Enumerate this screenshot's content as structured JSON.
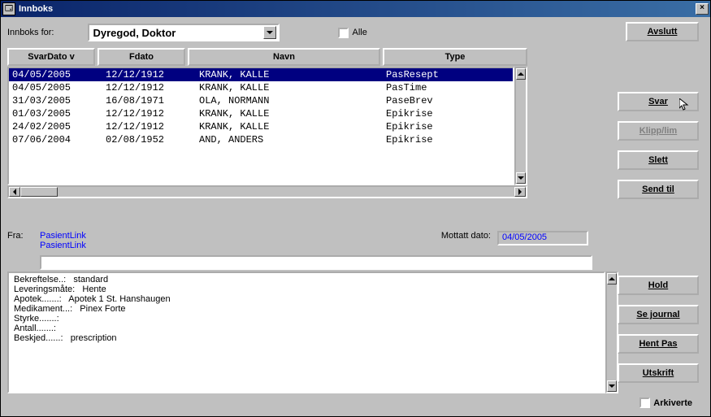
{
  "title": "Innboks",
  "labels": {
    "innboks_for": "Innboks for:",
    "alle": "Alle",
    "fra": "Fra:",
    "mottatt_dato": "Mottatt dato:",
    "arkiverte": "Arkiverte"
  },
  "dropdown": {
    "selected": "Dyregod, Doktor"
  },
  "headers": {
    "svardato": "SvarDato  v",
    "fdato": "Fdato",
    "navn": "Navn",
    "type": "Type"
  },
  "rows": [
    {
      "svardato": "04/05/2005",
      "fdato": "12/12/1912",
      "navn": "KRANK, KALLE",
      "type": "PasResept",
      "selected": true
    },
    {
      "svardato": "04/05/2005",
      "fdato": "12/12/1912",
      "navn": "KRANK, KALLE",
      "type": "PasTime",
      "selected": false
    },
    {
      "svardato": "31/03/2005",
      "fdato": "16/08/1971",
      "navn": "OLA, NORMANN",
      "type": "PaseBrev",
      "selected": false
    },
    {
      "svardato": "01/03/2005",
      "fdato": "12/12/1912",
      "navn": "KRANK, KALLE",
      "type": "Epikrise",
      "selected": false
    },
    {
      "svardato": "24/02/2005",
      "fdato": "12/12/1912",
      "navn": "KRANK, KALLE",
      "type": "Epikrise",
      "selected": false
    },
    {
      "svardato": "07/06/2004",
      "fdato": "02/08/1952",
      "navn": "AND, ANDERS",
      "type": "Epikrise",
      "selected": false
    }
  ],
  "fra_links": {
    "l1": "PasientLink",
    "l2": "PasientLink"
  },
  "mottatt_value": "04/05/2005",
  "details": "Bekreftelse..:   standard\nLeveringsmåte:   Hente\nApotek.......:   Apotek 1 St. Hanshaugen\nMedikament...:   Pinex Forte\nStyrke.......:\nAntall.......:\nBeskjed......:   prescription",
  "buttons": {
    "avslutt": "Avslutt",
    "svar": "Svar",
    "klipplim": "Klipp/lim",
    "slett": "Slett",
    "sendtil": "Send til",
    "hold": "Hold",
    "sejournal": "Se journal",
    "hentpas": "Hent Pas",
    "utskrift": "Utskrift"
  }
}
